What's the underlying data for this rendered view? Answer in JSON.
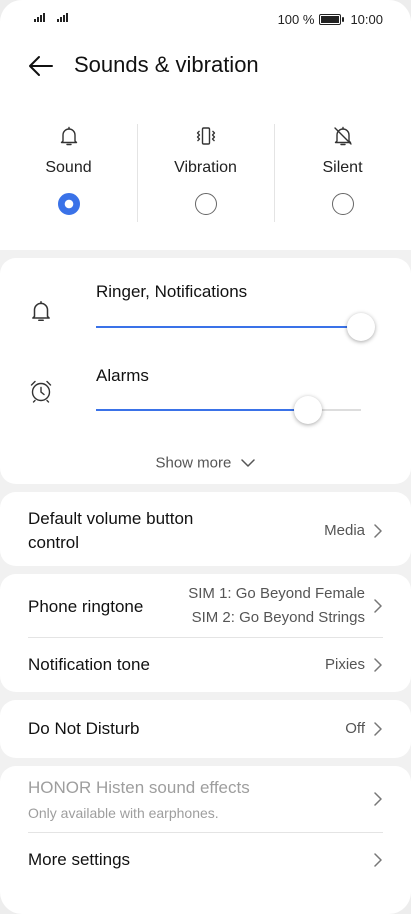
{
  "status_bar": {
    "battery": "100 %",
    "time": "10:00"
  },
  "header": {
    "title": "Sounds & vibration",
    "back_icon": "arrow-left-icon"
  },
  "modes": [
    {
      "label": "Sound",
      "icon": "bell-icon",
      "selected": true
    },
    {
      "label": "Vibration",
      "icon": "vibration-icon",
      "selected": false
    },
    {
      "label": "Silent",
      "icon": "bell-off-icon",
      "selected": false
    }
  ],
  "volumes": [
    {
      "label": "Ringer, Notifications",
      "icon": "bell-icon",
      "level": 1.0
    },
    {
      "label": "Alarms",
      "icon": "alarm-clock-icon",
      "level": 0.8
    }
  ],
  "show_more": "Show more",
  "default_volume": {
    "label_line1": "Default volume button",
    "label_line2": "control",
    "value": "Media"
  },
  "phone_ringtone": {
    "label": "Phone ringtone",
    "sim1": "SIM 1: Go Beyond Female",
    "sim2": "SIM 2: Go Beyond Strings"
  },
  "notification_tone": {
    "label": "Notification tone",
    "value": "Pixies"
  },
  "do_not_disturb": {
    "label": "Do Not Disturb",
    "value": "Off"
  },
  "histen": {
    "label": "HONOR Histen sound effects",
    "sub": "Only available with earphones."
  },
  "more_settings": {
    "label": "More settings"
  },
  "colors": {
    "accent": "#3a72e8",
    "background": "#f1f1f1",
    "card": "#ffffff"
  }
}
